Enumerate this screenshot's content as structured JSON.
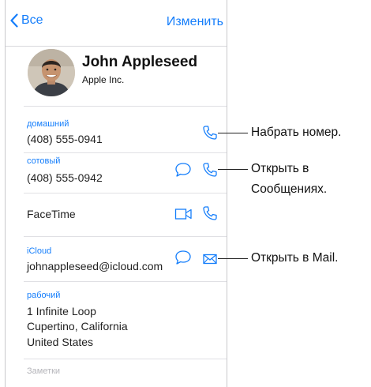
{
  "navbar": {
    "back_label": "Все",
    "edit_label": "Изменить"
  },
  "contact": {
    "name": "John Appleseed",
    "company": "Apple Inc."
  },
  "fields": {
    "home": {
      "label": "домашний",
      "value": "(408) 555-0941"
    },
    "mobile": {
      "label": "сотовый",
      "value": "(408) 555-0942"
    },
    "facetime": {
      "value": "FaceTime"
    },
    "icloud": {
      "label": "iCloud",
      "value": "johnappleseed@icloud.com"
    },
    "work": {
      "label": "рабочий",
      "line1": "1 Infinite Loop",
      "line2": "Cupertino, California",
      "line3": "United States"
    },
    "notes": {
      "label": "Заметки"
    }
  },
  "callouts": {
    "dial": "Набрать номер.",
    "messages_line1": "Открыть в",
    "messages_line2": "Сообщениях.",
    "mail": "Открыть в Mail."
  },
  "colors": {
    "accent": "#157efb",
    "separator": "#e0e0e4"
  }
}
